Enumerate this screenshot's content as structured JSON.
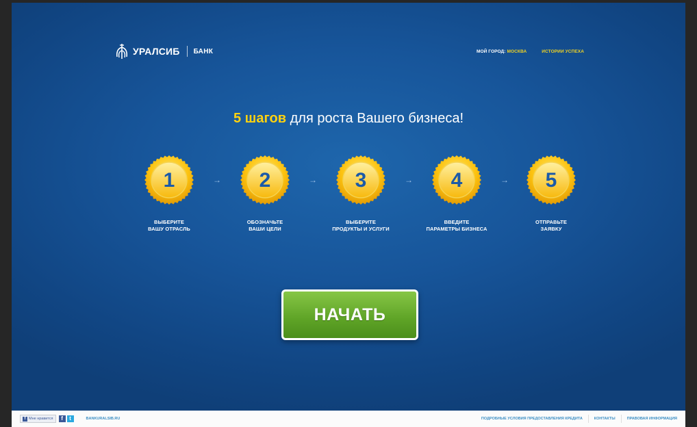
{
  "header": {
    "brand": "УРАЛСИБ",
    "brand_suffix": "БАНК",
    "nav": {
      "city_prefix": "МОЙ ГОРОД:",
      "city": "МОСКВА",
      "stories": "ИСТОРИИ УСПЕХА"
    }
  },
  "headline": {
    "highlight": "5 шагов",
    "rest": " для роста Вашего бизнеса!"
  },
  "steps": [
    {
      "number": "1",
      "label": "ВЫБЕРИТЕ\nВАШУ ОТРАСЛЬ"
    },
    {
      "number": "2",
      "label": "ОБОЗНАЧЬТЕ\nВАШИ ЦЕЛИ"
    },
    {
      "number": "3",
      "label": "ВЫБЕРИТЕ\nПРОДУКТЫ И УСЛУГИ"
    },
    {
      "number": "4",
      "label": "ВВЕДИТЕ\nПАРАМЕТРЫ БИЗНЕСА"
    },
    {
      "number": "5",
      "label": "ОТПРАВЬТЕ\nЗАЯВКУ"
    }
  ],
  "arrow_glyph": "→",
  "cta": {
    "label": "НАЧАТЬ"
  },
  "footer": {
    "like_label": "Мне нравится",
    "social": {
      "fb": "f",
      "tw": "t"
    },
    "site": "BANKURALSIB.RU",
    "links": [
      "ПОДРОБНЫЕ УСЛОВИЯ ПРЕДОСТАВЛЕНИЯ КРЕДИТА",
      "КОНТАКТЫ",
      "ПРАВОВАЯ ИНФОРМАЦИЯ"
    ]
  },
  "colors": {
    "background": "#17559a",
    "accent_yellow": "#ffd20f",
    "cta_green": "#5ea326"
  }
}
